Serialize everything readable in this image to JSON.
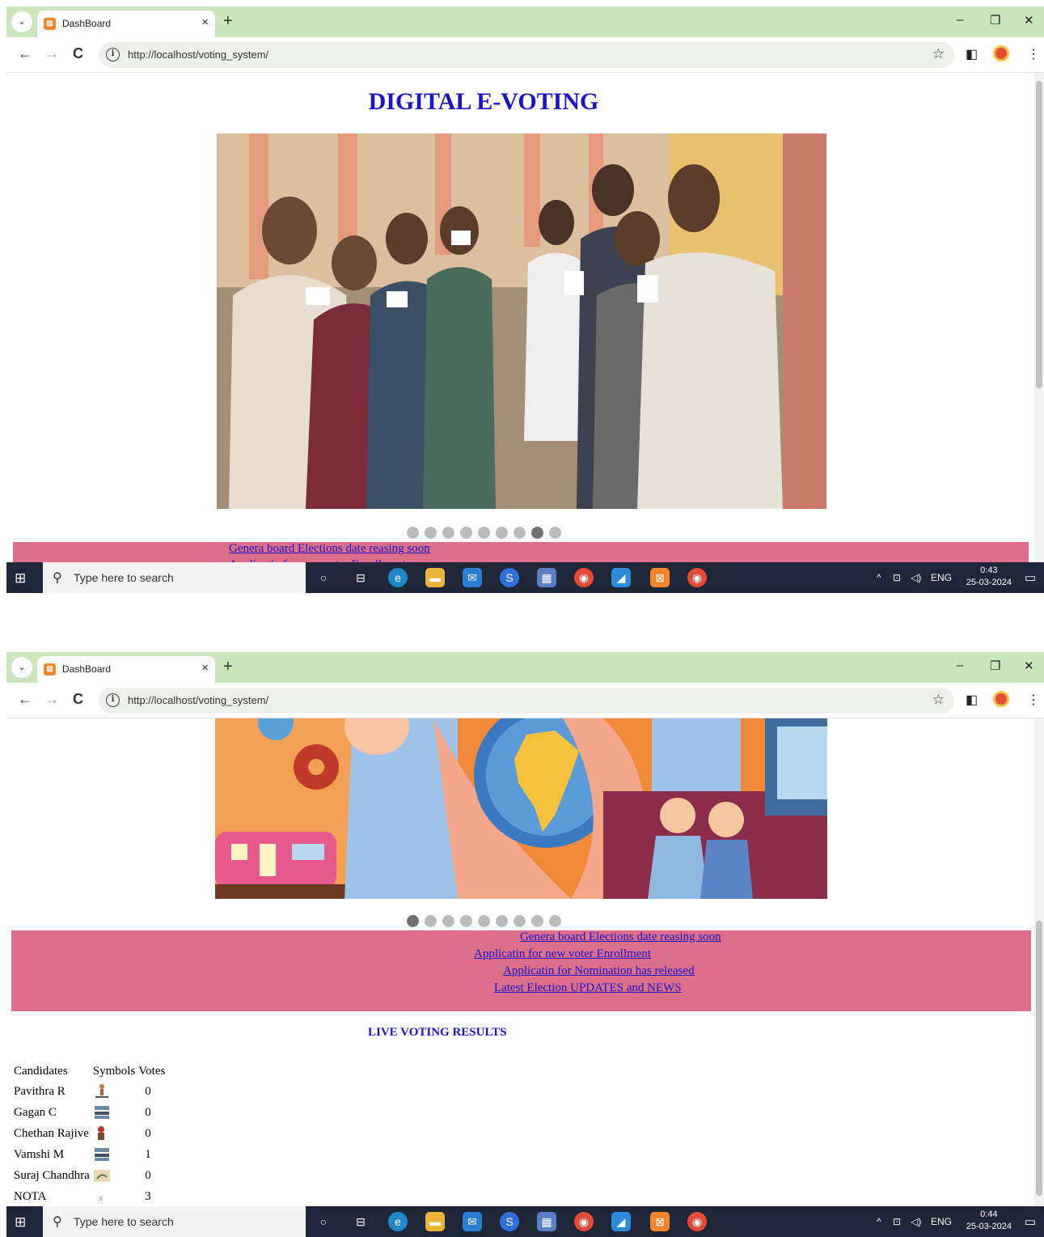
{
  "browser": {
    "tab_title": "DashBoard",
    "url": "http://localhost/voting_system/",
    "new_tab": "+",
    "close_tab": "×",
    "tab_menu": "⌄",
    "minimize": "–",
    "restore": "❐",
    "close": "✕",
    "back": "←",
    "forward": "→",
    "reload": "C",
    "star": "☆",
    "sidepanel": "◧",
    "menu": "⋮",
    "info": "i"
  },
  "page": {
    "title": "DIGITAL E-VOTING",
    "slideshow": {
      "dot_count": 9,
      "active_dot_first": 8,
      "active_dot_second": 1
    },
    "news": [
      "Genera board Elections date reasing soon",
      "Applicatin for new voter Enrollment",
      "Applicatin for Nomination has released",
      "Latest Election UPDATES and NEWS"
    ],
    "results_title": "LIVE VOTING RESULTS",
    "results_headers": [
      "Candidates",
      "Symbols",
      "Votes"
    ],
    "results": [
      {
        "name": "Pavithra R",
        "symbol": "person-icon",
        "votes": "0"
      },
      {
        "name": "Gagan C",
        "symbol": "boat-icon",
        "votes": "0"
      },
      {
        "name": "Chethan Rajive",
        "symbol": "figure-icon",
        "votes": "0"
      },
      {
        "name": "Vamshi M",
        "symbol": "boat-icon",
        "votes": "1"
      },
      {
        "name": "Suraj Chandhra",
        "symbol": "sickle-icon",
        "votes": "0"
      },
      {
        "name": "NOTA",
        "symbol": "nota-icon",
        "votes": "3"
      }
    ]
  },
  "taskbar": {
    "search_placeholder": "Type here to search",
    "lang": "ENG",
    "tray_caret": "^",
    "time_first": "0:43",
    "time_second": "0:44",
    "date": "25-03-2024"
  },
  "colors": {
    "heading": "#1a14c8",
    "newsbar": "#dc6e8c",
    "tabbar": "#cbe6bd"
  }
}
